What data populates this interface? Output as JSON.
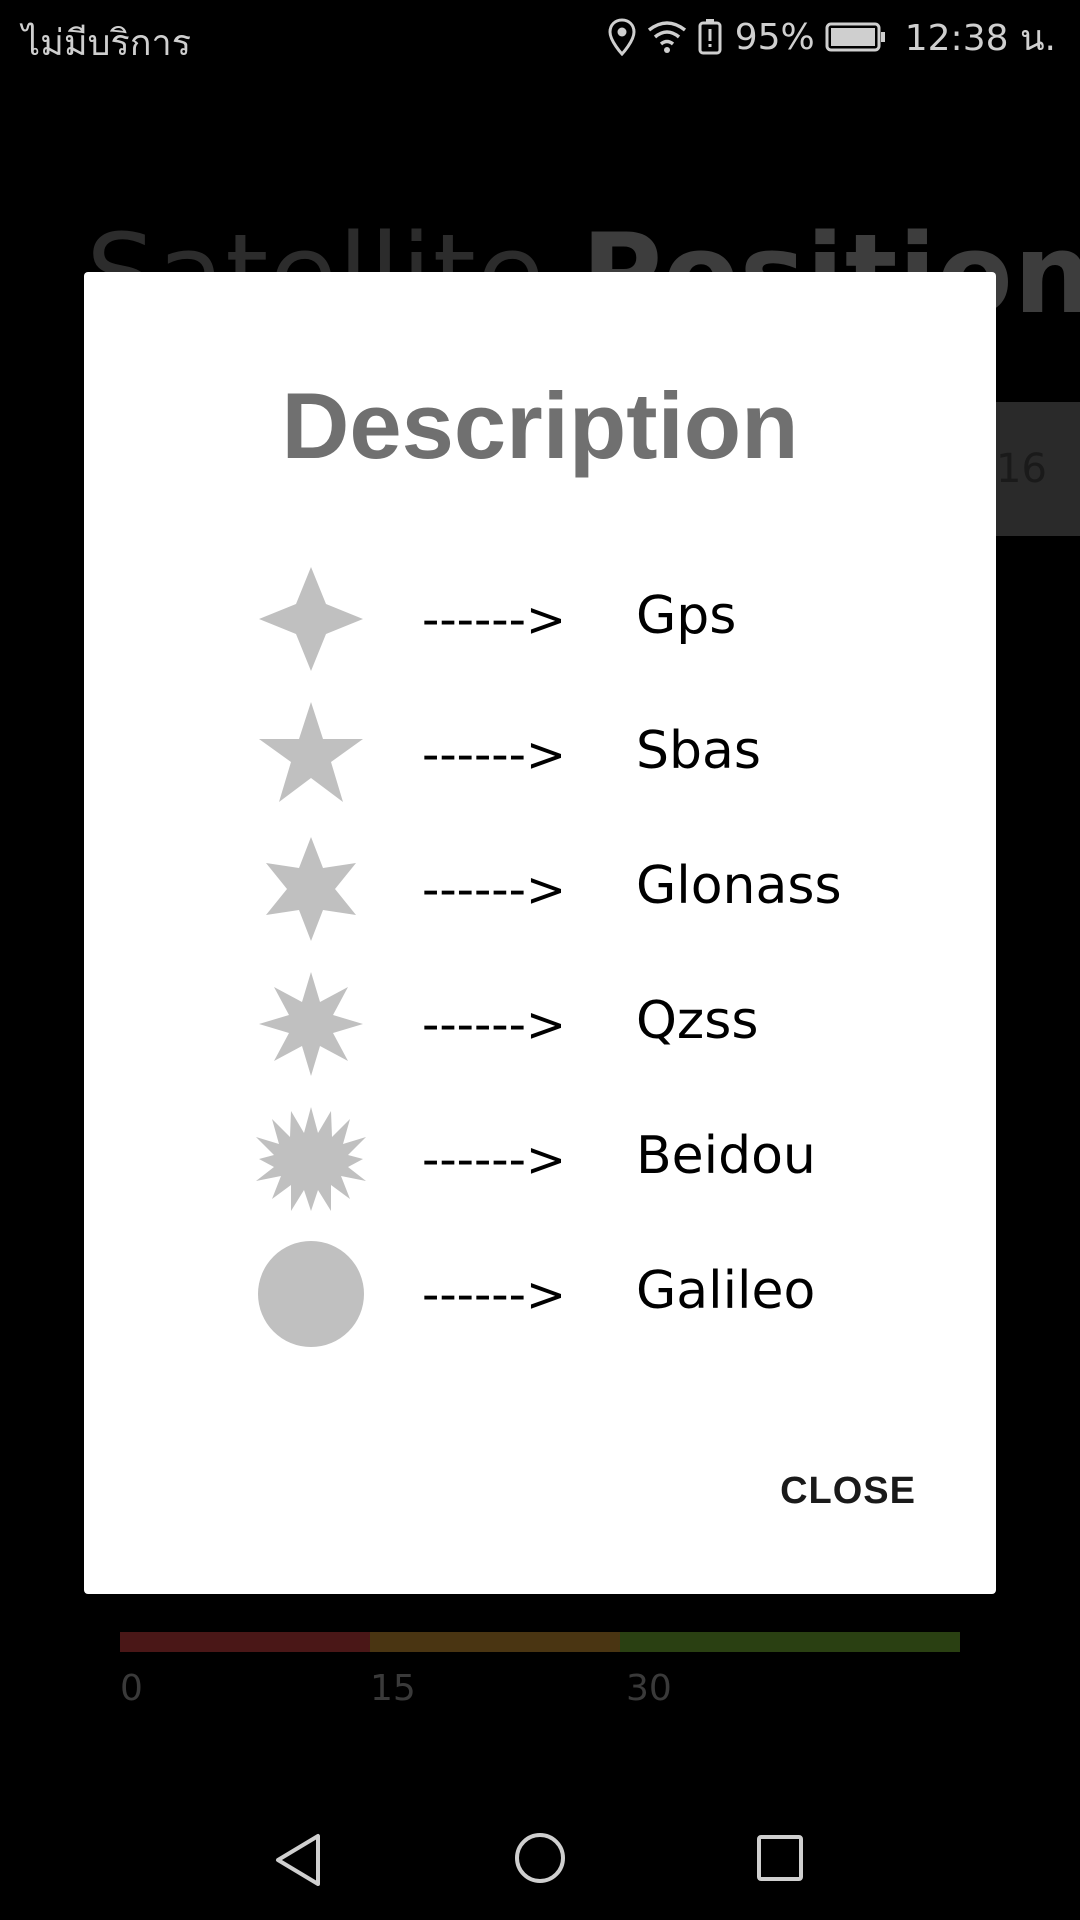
{
  "status_bar": {
    "carrier": "ไม่มีบริการ",
    "battery_percent": "95%",
    "time": "12:38 น.",
    "icons": [
      "location-icon",
      "wifi-icon",
      "battery-saver-icon",
      "battery-icon"
    ]
  },
  "background": {
    "title_light": "Satellite",
    "title_bold": "Position",
    "count": "16",
    "snr_ticks": [
      "0",
      "15",
      "30"
    ],
    "snr_colors": [
      "#4a1717",
      "#4a3512",
      "#2a4012"
    ]
  },
  "dialog": {
    "title": "Description",
    "items": [
      {
        "icon": "four-point-star-icon",
        "arrow": "------>",
        "label": "Gps"
      },
      {
        "icon": "five-point-star-icon",
        "arrow": "------>",
        "label": "Sbas"
      },
      {
        "icon": "six-point-star-icon",
        "arrow": "------>",
        "label": "Glonass"
      },
      {
        "icon": "eight-point-star-icon",
        "arrow": "------>",
        "label": "Qzss"
      },
      {
        "icon": "starburst-icon",
        "arrow": "------>",
        "label": "Beidou"
      },
      {
        "icon": "circle-icon",
        "arrow": "------>",
        "label": "Galileo"
      }
    ],
    "close_label": "CLOSE",
    "icon_color": "#c0c0c0"
  },
  "nav_bar": {
    "icons": [
      "back-icon",
      "home-icon",
      "recents-icon"
    ]
  }
}
